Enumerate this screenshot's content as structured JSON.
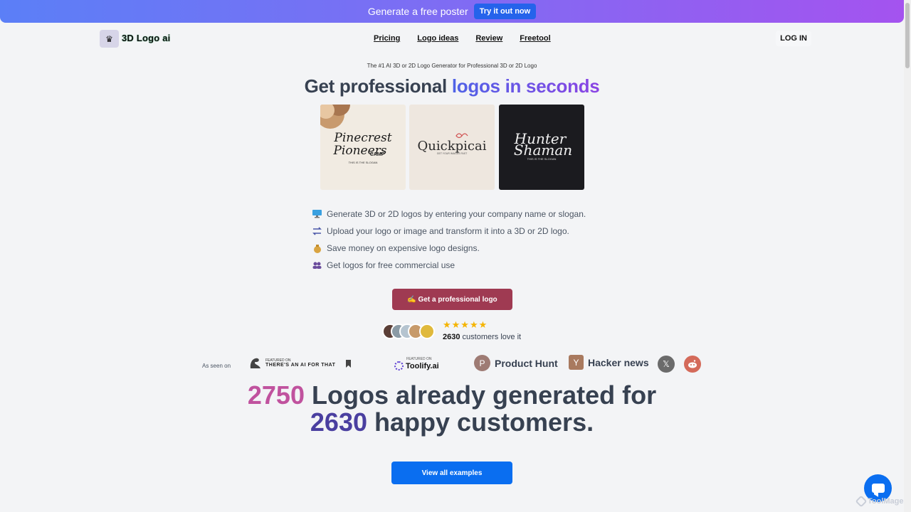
{
  "promo": {
    "text": "Generate a free poster",
    "button": "Try it out now"
  },
  "nav": {
    "brand": "3D Logo ai",
    "links": [
      "Pricing",
      "Logo ideas",
      "Review",
      "Freetool"
    ],
    "login": "LOG IN"
  },
  "hero": {
    "tagline": "The #1 AI 3D or 2D Logo Generator for Professional 3D or 2D Logo",
    "headline_plain": "Get professional",
    "headline_accent": "logos in seconds"
  },
  "examples": [
    {
      "line1": "Pinecrest",
      "line2": "Pioneers",
      "line3": "CAMP",
      "slogan": "THIS IS THE SLOGAN"
    },
    {
      "line1": "Quickpicai",
      "slogan": "GET YOUR IMAGES FAST"
    },
    {
      "line1": "Hunter",
      "line2": "Shaman",
      "slogan": "THIS IS THE SLOGAN"
    }
  ],
  "features": [
    {
      "icon": "computer-icon",
      "text": "Generate 3D or 2D logos by entering your company name or slogan."
    },
    {
      "icon": "transform-icon",
      "text": "Upload your logo or image and transform it into a 3D or 2D logo."
    },
    {
      "icon": "money-bag-icon",
      "text": "Save money on expensive logo designs."
    },
    {
      "icon": "people-icon",
      "text": "Get logos for free commercial use"
    }
  ],
  "cta": {
    "label": "✍️ Get a professional logo"
  },
  "social_proof": {
    "stars": "★★★★★",
    "count": "2630",
    "suffix": " customers love it"
  },
  "seen_on": {
    "label": "As seen on",
    "aift_small": "FEATURED ON",
    "aift_name": "THERE'S AN AI FOR THAT",
    "toolify_small": "FEATURED ON",
    "toolify_name": "Toolify.ai",
    "ph_letter": "P",
    "ph_name": "Product Hunt",
    "hn_letter": "Y",
    "hn_name": "Hacker news",
    "x_letter": "𝕏"
  },
  "stats": {
    "logos": "2750",
    "logos_text": " Logos already generated for",
    "customers": "2630",
    "customers_text": " happy customers."
  },
  "view_examples": "View all examples",
  "watermark": "ToolMage",
  "colors": {
    "promo_start": "#5b7ff7",
    "promo_end": "#a453ef",
    "cta": "#9f3a52",
    "primary_blue": "#0a6ef0",
    "stat_pink": "#c0529e",
    "stat_purple": "#4a3fa0"
  }
}
